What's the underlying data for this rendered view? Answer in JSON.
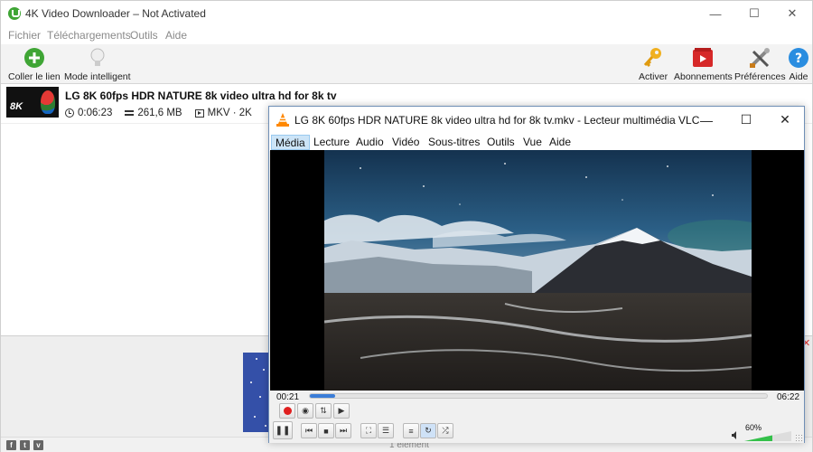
{
  "downloader": {
    "title": "4K Video Downloader – Not Activated",
    "menu": [
      "Fichier",
      "Téléchargements",
      "Outils",
      "Aide"
    ],
    "toolbar": {
      "paste_link": "Coller le lien",
      "smart_mode": "Mode intelligent",
      "activate": "Activer",
      "subscriptions": "Abonnements",
      "preferences": "Préférences",
      "help": "Aide"
    },
    "item": {
      "thumb_text": "8K",
      "title": "LG 8K 60fps HDR NATURE 8k video ultra hd for 8k tv",
      "duration": "0:06:23",
      "size": "261,6 MB",
      "format": "MKV · 2K"
    },
    "status": "1 élément",
    "social": [
      "f",
      "t",
      "v"
    ]
  },
  "vlc": {
    "title": "LG 8K 60fps HDR NATURE 8k video ultra hd for 8k tv.mkv - Lecteur multimédia VLC",
    "menu": [
      "Média",
      "Lecture",
      "Audio",
      "Vidéo",
      "Sous-titres",
      "Outils",
      "Vue",
      "Aide"
    ],
    "active_menu": "Média",
    "time_elapsed": "00:21",
    "time_total": "06:22",
    "progress_fraction": 0.055,
    "volume_label": "60%",
    "volume_fraction": 0.6
  },
  "colors": {
    "accent_blue": "#3b7dd8",
    "volume_green": "#34c04a",
    "record_red": "#e02020",
    "add_green": "#3fa535",
    "help_blue": "#2a8de0",
    "key_gold": "#f0b020"
  }
}
